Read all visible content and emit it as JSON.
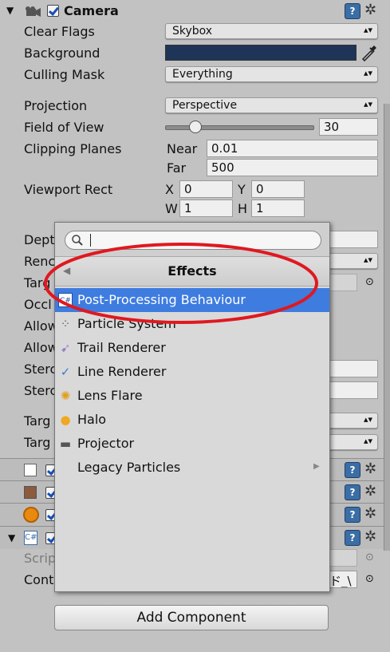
{
  "header": {
    "title": "Camera"
  },
  "camera": {
    "clear_flags": {
      "label": "Clear Flags",
      "value": "Skybox"
    },
    "background": {
      "label": "Background",
      "color": "#1f3557"
    },
    "culling_mask": {
      "label": "Culling Mask",
      "value": "Everything"
    },
    "projection": {
      "label": "Projection",
      "value": "Perspective"
    },
    "fov": {
      "label": "Field of View",
      "value": "30",
      "slider_fraction": 0.2
    },
    "clipping": {
      "label": "Clipping Planes",
      "near_label": "Near",
      "near": "0.01",
      "far_label": "Far",
      "far": "500"
    },
    "viewport": {
      "label": "Viewport Rect",
      "x_label": "X",
      "x": "0",
      "y_label": "Y",
      "y": "0",
      "w_label": "W",
      "w": "1",
      "h_label": "H",
      "h": "1"
    },
    "hidden_labels": [
      "Dept",
      "Renc",
      "Targ",
      "Occl",
      "Allow",
      "Allow",
      "Sterc",
      "Sterc",
      "Targ",
      "Targ"
    ]
  },
  "script_component": {
    "script_label": "Scrip",
    "cont_label": "Cont",
    "cont_value": "ド_\\"
  },
  "menu": {
    "search_placeholder": "",
    "title": "Effects",
    "items": [
      {
        "label": "Post-Processing Behaviour",
        "icon": "script-icon",
        "selected": true
      },
      {
        "label": "Particle System",
        "icon": "particle-icon",
        "selected": false
      },
      {
        "label": "Trail Renderer",
        "icon": "trail-icon",
        "selected": false
      },
      {
        "label": "Line Renderer",
        "icon": "line-icon",
        "selected": false
      },
      {
        "label": "Lens Flare",
        "icon": "lens-flare-icon",
        "selected": false
      },
      {
        "label": "Halo",
        "icon": "halo-icon",
        "selected": false
      },
      {
        "label": "Projector",
        "icon": "projector-icon",
        "selected": false
      },
      {
        "label": "Legacy Particles",
        "icon": "",
        "selected": false,
        "submenu": true
      }
    ]
  },
  "add_component": {
    "label": "Add Component"
  },
  "annotation_color": "#e01820",
  "selection_color": "#3e7ce0"
}
